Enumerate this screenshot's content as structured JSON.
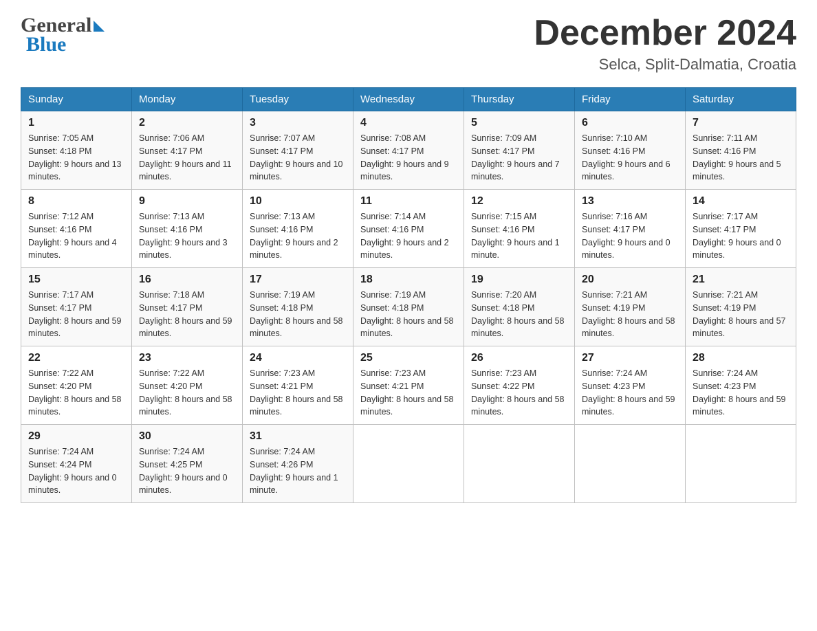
{
  "header": {
    "logo_general": "General",
    "logo_blue": "Blue",
    "month_title": "December 2024",
    "location": "Selca, Split-Dalmatia, Croatia"
  },
  "days_of_week": [
    "Sunday",
    "Monday",
    "Tuesday",
    "Wednesday",
    "Thursday",
    "Friday",
    "Saturday"
  ],
  "weeks": [
    [
      {
        "day": "1",
        "sunrise": "7:05 AM",
        "sunset": "4:18 PM",
        "daylight": "9 hours and 13 minutes."
      },
      {
        "day": "2",
        "sunrise": "7:06 AM",
        "sunset": "4:17 PM",
        "daylight": "9 hours and 11 minutes."
      },
      {
        "day": "3",
        "sunrise": "7:07 AM",
        "sunset": "4:17 PM",
        "daylight": "9 hours and 10 minutes."
      },
      {
        "day": "4",
        "sunrise": "7:08 AM",
        "sunset": "4:17 PM",
        "daylight": "9 hours and 9 minutes."
      },
      {
        "day": "5",
        "sunrise": "7:09 AM",
        "sunset": "4:17 PM",
        "daylight": "9 hours and 7 minutes."
      },
      {
        "day": "6",
        "sunrise": "7:10 AM",
        "sunset": "4:16 PM",
        "daylight": "9 hours and 6 minutes."
      },
      {
        "day": "7",
        "sunrise": "7:11 AM",
        "sunset": "4:16 PM",
        "daylight": "9 hours and 5 minutes."
      }
    ],
    [
      {
        "day": "8",
        "sunrise": "7:12 AM",
        "sunset": "4:16 PM",
        "daylight": "9 hours and 4 minutes."
      },
      {
        "day": "9",
        "sunrise": "7:13 AM",
        "sunset": "4:16 PM",
        "daylight": "9 hours and 3 minutes."
      },
      {
        "day": "10",
        "sunrise": "7:13 AM",
        "sunset": "4:16 PM",
        "daylight": "9 hours and 2 minutes."
      },
      {
        "day": "11",
        "sunrise": "7:14 AM",
        "sunset": "4:16 PM",
        "daylight": "9 hours and 2 minutes."
      },
      {
        "day": "12",
        "sunrise": "7:15 AM",
        "sunset": "4:16 PM",
        "daylight": "9 hours and 1 minute."
      },
      {
        "day": "13",
        "sunrise": "7:16 AM",
        "sunset": "4:17 PM",
        "daylight": "9 hours and 0 minutes."
      },
      {
        "day": "14",
        "sunrise": "7:17 AM",
        "sunset": "4:17 PM",
        "daylight": "9 hours and 0 minutes."
      }
    ],
    [
      {
        "day": "15",
        "sunrise": "7:17 AM",
        "sunset": "4:17 PM",
        "daylight": "8 hours and 59 minutes."
      },
      {
        "day": "16",
        "sunrise": "7:18 AM",
        "sunset": "4:17 PM",
        "daylight": "8 hours and 59 minutes."
      },
      {
        "day": "17",
        "sunrise": "7:19 AM",
        "sunset": "4:18 PM",
        "daylight": "8 hours and 58 minutes."
      },
      {
        "day": "18",
        "sunrise": "7:19 AM",
        "sunset": "4:18 PM",
        "daylight": "8 hours and 58 minutes."
      },
      {
        "day": "19",
        "sunrise": "7:20 AM",
        "sunset": "4:18 PM",
        "daylight": "8 hours and 58 minutes."
      },
      {
        "day": "20",
        "sunrise": "7:21 AM",
        "sunset": "4:19 PM",
        "daylight": "8 hours and 58 minutes."
      },
      {
        "day": "21",
        "sunrise": "7:21 AM",
        "sunset": "4:19 PM",
        "daylight": "8 hours and 57 minutes."
      }
    ],
    [
      {
        "day": "22",
        "sunrise": "7:22 AM",
        "sunset": "4:20 PM",
        "daylight": "8 hours and 58 minutes."
      },
      {
        "day": "23",
        "sunrise": "7:22 AM",
        "sunset": "4:20 PM",
        "daylight": "8 hours and 58 minutes."
      },
      {
        "day": "24",
        "sunrise": "7:23 AM",
        "sunset": "4:21 PM",
        "daylight": "8 hours and 58 minutes."
      },
      {
        "day": "25",
        "sunrise": "7:23 AM",
        "sunset": "4:21 PM",
        "daylight": "8 hours and 58 minutes."
      },
      {
        "day": "26",
        "sunrise": "7:23 AM",
        "sunset": "4:22 PM",
        "daylight": "8 hours and 58 minutes."
      },
      {
        "day": "27",
        "sunrise": "7:24 AM",
        "sunset": "4:23 PM",
        "daylight": "8 hours and 59 minutes."
      },
      {
        "day": "28",
        "sunrise": "7:24 AM",
        "sunset": "4:23 PM",
        "daylight": "8 hours and 59 minutes."
      }
    ],
    [
      {
        "day": "29",
        "sunrise": "7:24 AM",
        "sunset": "4:24 PM",
        "daylight": "9 hours and 0 minutes."
      },
      {
        "day": "30",
        "sunrise": "7:24 AM",
        "sunset": "4:25 PM",
        "daylight": "9 hours and 0 minutes."
      },
      {
        "day": "31",
        "sunrise": "7:24 AM",
        "sunset": "4:26 PM",
        "daylight": "9 hours and 1 minute."
      },
      null,
      null,
      null,
      null
    ]
  ]
}
